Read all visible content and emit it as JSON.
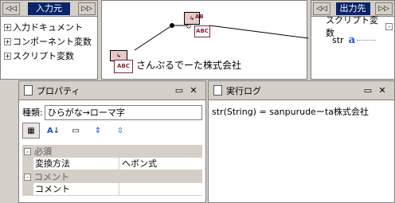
{
  "left_panel": {
    "title": "入力元",
    "items": [
      {
        "expander": "+",
        "label": "入力ドキュメント"
      },
      {
        "expander": "+",
        "label": "コンポーネント変数"
      },
      {
        "expander": "+",
        "label": "スクリプト変数"
      }
    ]
  },
  "right_panel": {
    "title": "出力先",
    "tree_label": "スクリプト変数",
    "tree_expander": "-",
    "item_label": "str"
  },
  "canvas": {
    "component_label": "さんぷるでーた株式会社",
    "icon_small_text": "ABC",
    "icon_big_text": "AB",
    "icon_big_subtext": "ABC"
  },
  "property_window": {
    "title": "プロパティ",
    "kind_label": "種類:",
    "kind_value": "ひらがな→ローマ字",
    "sections": [
      {
        "expander": "-",
        "label": "必須",
        "rows": [
          {
            "name": "変換方法",
            "value": "ヘボン式"
          }
        ]
      },
      {
        "expander": "-",
        "label": "コメント",
        "rows": [
          {
            "name": "コメント",
            "value": ""
          }
        ]
      }
    ]
  },
  "log_window": {
    "title": "実行ログ",
    "text": "str(String) = sanpurudeーta株式会社"
  },
  "nav": {
    "prev": "◁◁",
    "next": "▷▷"
  },
  "window_buttons": {
    "restore": "▭",
    "close": "✕"
  },
  "colors": {
    "accent": "#0a246a",
    "chrome": "#d4d0c8"
  }
}
